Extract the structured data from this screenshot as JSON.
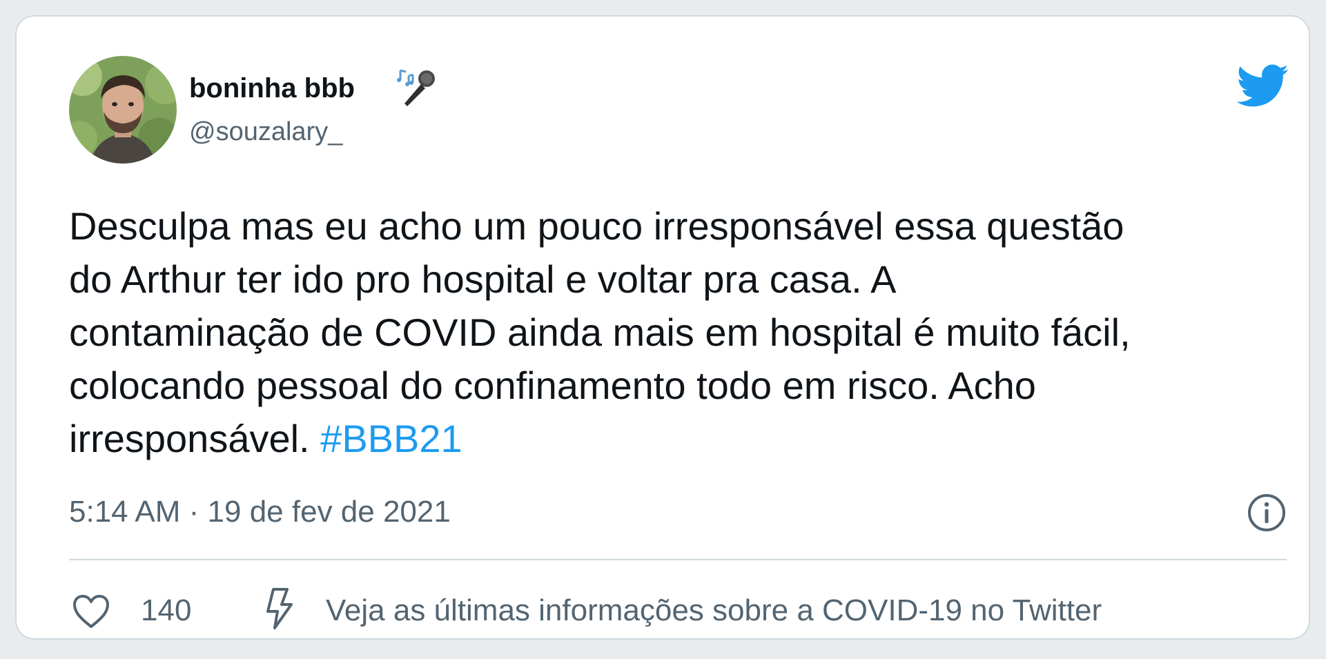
{
  "tweet": {
    "author": {
      "display_name": "boninha bbb",
      "handle": "@souzalary_",
      "name_emoji": "microphone-music-icon"
    },
    "brand_icon": "twitter-bird-icon",
    "text_lines": [
      "Desculpa mas eu acho um pouco irresponsável essa questão",
      "do Arthur ter ido pro hospital e voltar pra casa. A",
      "contaminação de COVID ainda mais em hospital é muito fácil,",
      "colocando pessoal do confinamento todo em risco. Acho",
      "irresponsável. "
    ],
    "hashtag": "#BBB21",
    "timestamp": "5:14 AM · 19 de fev de 2021",
    "info_icon": "info-icon",
    "like_icon": "heart-icon",
    "like_count": "140",
    "covid_icon": "bolt-icon",
    "covid_link": "Veja as últimas informações sobre a COVID-19 no Twitter"
  },
  "colors": {
    "text_primary": "#0f1419",
    "text_secondary": "#536471",
    "accent": "#1d9bf0",
    "border": "#cfd9de"
  }
}
